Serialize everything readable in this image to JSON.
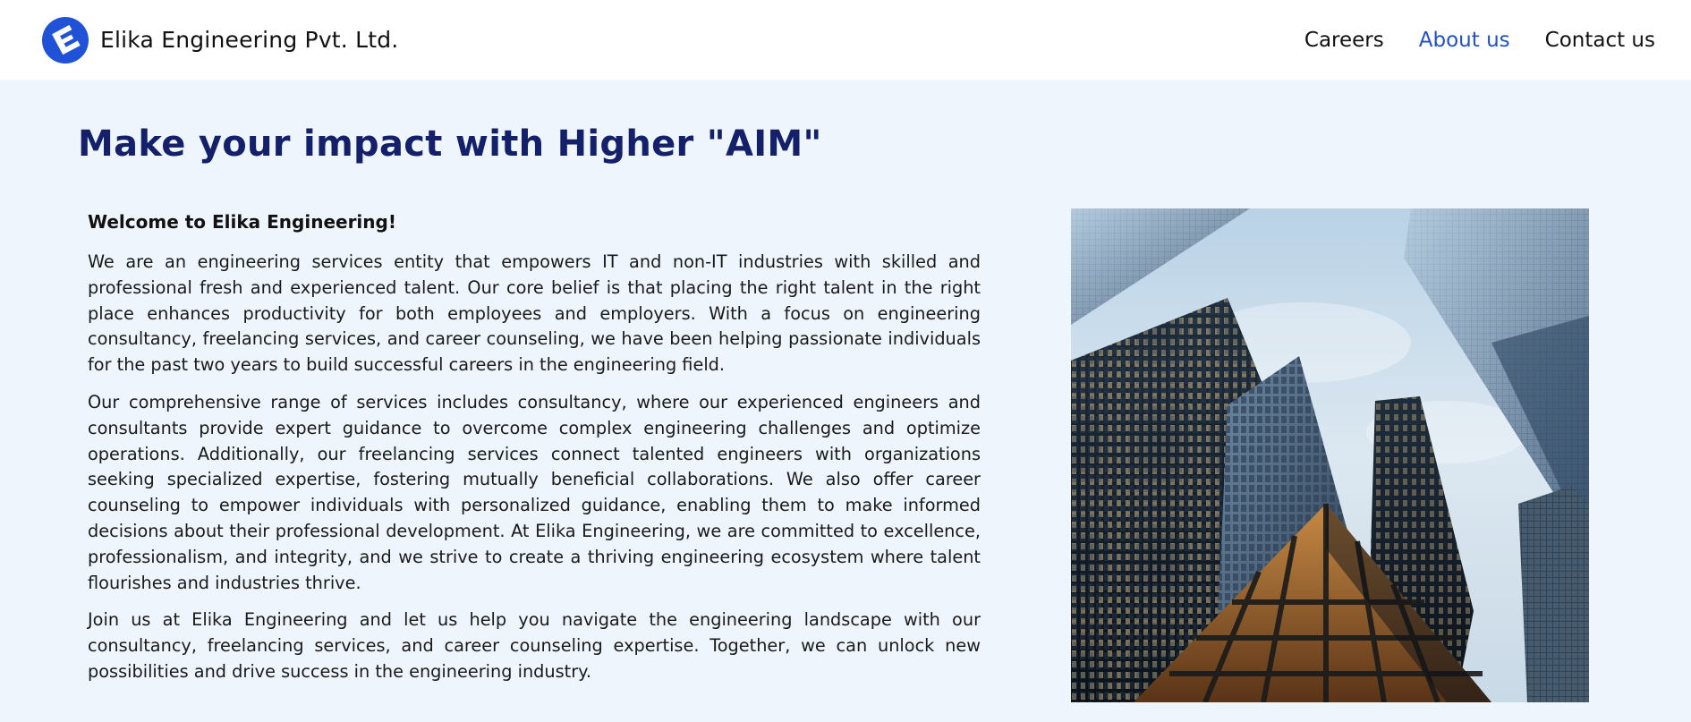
{
  "header": {
    "brand_name": "Elika Engineering Pvt. Ltd.",
    "nav": [
      {
        "label": "Careers",
        "active": false
      },
      {
        "label": "About us",
        "active": true
      },
      {
        "label": "Contact us",
        "active": false
      }
    ]
  },
  "main": {
    "headline": "Make your impact with Higher \"AIM\"",
    "welcome": "Welcome to Elika Engineering!",
    "paragraphs": [
      "We are an engineering services entity that empowers IT and non-IT industries with skilled and professional fresh and experienced talent. Our core belief is that placing the right talent in the right place enhances productivity for both employees and employers. With a focus on engineering consultancy, freelancing services, and career counseling, we have been helping passionate individuals for the past two years to build successful careers in the engineering field.",
      "Our comprehensive range of services includes consultancy, where our experienced engineers and consultants provide expert guidance to overcome complex engineering challenges and optimize operations. Additionally, our freelancing services connect talented engineers with organizations seeking specialized expertise, fostering mutually beneficial collaborations. We also offer career counseling to empower individuals with personalized guidance, enabling them to make informed decisions about their professional development. At Elika Engineering, we are committed to excellence, professionalism, and integrity, and we strive to create a thriving engineering ecosystem where talent flourishes and industries thrive.",
      "Join us at Elika Engineering and let us help you navigate the engineering landscape with our consultancy, freelancing services, and career counseling expertise. Together, we can unlock new possibilities and drive success in the engineering industry."
    ]
  },
  "colors": {
    "brand_blue": "#1f52d6",
    "heading_navy": "#14216a",
    "active_link": "#2250c9",
    "page_background": "#eef5fc"
  }
}
